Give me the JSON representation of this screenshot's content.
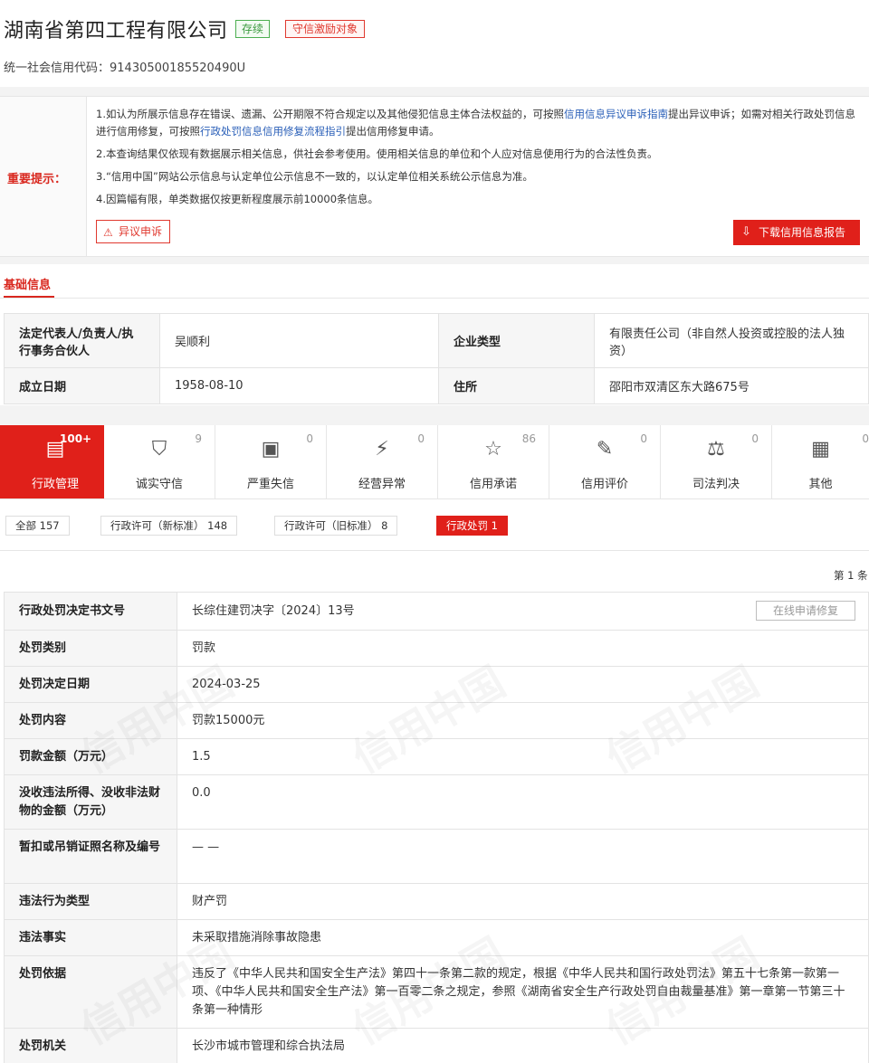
{
  "company": {
    "name": "湖南省第四工程有限公司",
    "status_badge": "存续",
    "incentive_badge": "守信激励对象",
    "credit_code_label": "统一社会信用代码：",
    "credit_code": "91430500185520490U"
  },
  "notice": {
    "label": "重要提示：",
    "line1_a": "1.如认为所展示信息存在错误、遗漏、公开期限不符合规定以及其他侵犯信息主体合法权益的，可按照",
    "line1_link": "信用信息异议申诉指南",
    "line1_b": "提出异议申诉；如需对相关行政处罚信息进行信用修复，可按照",
    "line1_link2": "行政处罚信息信用修复流程指引",
    "line1_c": "提出信用修复申请。",
    "line2": "2.本查询结果仅依现有数据展示相关信息，供社会参考使用。使用相关信息的单位和个人应对信息使用行为的合法性负责。",
    "line3": "3.“信用中国”网站公示信息与认定单位公示信息不一致的，以认定单位相关系统公示信息为准。",
    "line4": "4.因篇幅有限，单类数据仅按更新程度展示前10000条信息。",
    "objection_button": "异议申诉",
    "download_button": "下载信用信息报告"
  },
  "basic": {
    "section_title": "基础信息",
    "rep_label": "法定代表人/负责人/执行事务合伙人",
    "rep_value": "吴顺利",
    "type_label": "企业类型",
    "type_value": "有限责任公司（非自然人投资或控股的法人独资）",
    "date_label": "成立日期",
    "date_value": "1958-08-10",
    "addr_label": "住所",
    "addr_value": "邵阳市双清区东大路675号"
  },
  "categories": [
    {
      "label": "行政管理",
      "count": "100+",
      "icon": "admin-doc-icon"
    },
    {
      "label": "诚实守信",
      "count": "9",
      "icon": "honest-shield-icon"
    },
    {
      "label": "严重失信",
      "count": "0",
      "icon": "dishonest-icon"
    },
    {
      "label": "经营异常",
      "count": "0",
      "icon": "alarm-icon"
    },
    {
      "label": "信用承诺",
      "count": "86",
      "icon": "promise-doc-icon"
    },
    {
      "label": "信用评价",
      "count": "0",
      "icon": "evaluation-icon"
    },
    {
      "label": "司法判决",
      "count": "0",
      "icon": "judgement-icon"
    },
    {
      "label": "其他",
      "count": "0",
      "icon": "other-doc-icon"
    }
  ],
  "filters": [
    {
      "label": "全部  157"
    },
    {
      "label": "行政许可（新标准）  148"
    },
    {
      "label": "行政许可（旧标准）  8"
    },
    {
      "label": "行政处罚  1"
    }
  ],
  "page_indicator": "第 1 条",
  "detail": {
    "repair_button": "在线申请修复",
    "rows": [
      {
        "k": "行政处罚决定书文号",
        "v": "长综住建罚决字〔2024〕13号"
      },
      {
        "k": "处罚类别",
        "v": "罚款"
      },
      {
        "k": "处罚决定日期",
        "v": "2024-03-25"
      },
      {
        "k": "处罚内容",
        "v": "罚款15000元"
      },
      {
        "k": "罚款金额（万元）",
        "v": "1.5"
      },
      {
        "k": "没收违法所得、没收非法财物的金额（万元）",
        "v": "0.0"
      },
      {
        "k": "暂扣或吊销证照名称及编号",
        "v": "— —"
      },
      {
        "k": "违法行为类型",
        "v": "财产罚"
      },
      {
        "k": "违法事实",
        "v": "未采取措施消除事故隐患"
      },
      {
        "k": "处罚依据",
        "v": "违反了《中华人民共和国安全生产法》第四十一条第二款的规定，根据《中华人民共和国行政处罚法》第五十七条第一款第一项、《中华人民共和国安全生产法》第一百零二条之规定，参照《湖南省安全生产行政处罚自由裁量基准》第一章第一节第三十条第一种情形"
      },
      {
        "k": "处罚机关",
        "v": "长沙市城市管理和综合执法局"
      }
    ]
  },
  "watermark": "信用中国"
}
